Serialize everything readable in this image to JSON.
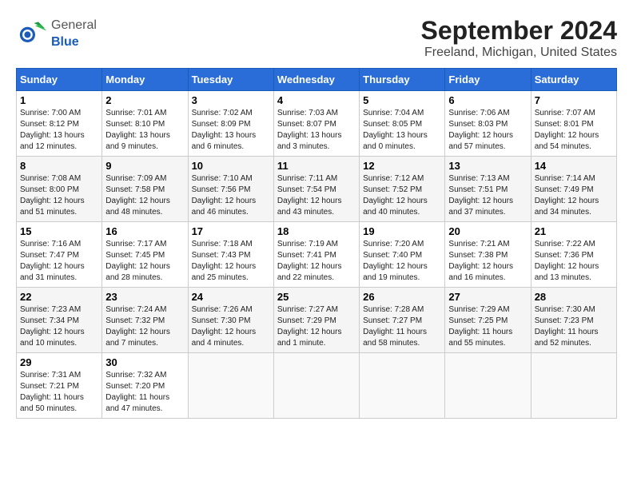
{
  "header": {
    "logo_general": "General",
    "logo_blue": "Blue",
    "title": "September 2024",
    "subtitle": "Freeland, Michigan, United States"
  },
  "weekdays": [
    "Sunday",
    "Monday",
    "Tuesday",
    "Wednesday",
    "Thursday",
    "Friday",
    "Saturday"
  ],
  "weeks": [
    [
      {
        "day": "1",
        "info": "Sunrise: 7:00 AM\nSunset: 8:12 PM\nDaylight: 13 hours\nand 12 minutes."
      },
      {
        "day": "2",
        "info": "Sunrise: 7:01 AM\nSunset: 8:10 PM\nDaylight: 13 hours\nand 9 minutes."
      },
      {
        "day": "3",
        "info": "Sunrise: 7:02 AM\nSunset: 8:09 PM\nDaylight: 13 hours\nand 6 minutes."
      },
      {
        "day": "4",
        "info": "Sunrise: 7:03 AM\nSunset: 8:07 PM\nDaylight: 13 hours\nand 3 minutes."
      },
      {
        "day": "5",
        "info": "Sunrise: 7:04 AM\nSunset: 8:05 PM\nDaylight: 13 hours\nand 0 minutes."
      },
      {
        "day": "6",
        "info": "Sunrise: 7:06 AM\nSunset: 8:03 PM\nDaylight: 12 hours\nand 57 minutes."
      },
      {
        "day": "7",
        "info": "Sunrise: 7:07 AM\nSunset: 8:01 PM\nDaylight: 12 hours\nand 54 minutes."
      }
    ],
    [
      {
        "day": "8",
        "info": "Sunrise: 7:08 AM\nSunset: 8:00 PM\nDaylight: 12 hours\nand 51 minutes."
      },
      {
        "day": "9",
        "info": "Sunrise: 7:09 AM\nSunset: 7:58 PM\nDaylight: 12 hours\nand 48 minutes."
      },
      {
        "day": "10",
        "info": "Sunrise: 7:10 AM\nSunset: 7:56 PM\nDaylight: 12 hours\nand 46 minutes."
      },
      {
        "day": "11",
        "info": "Sunrise: 7:11 AM\nSunset: 7:54 PM\nDaylight: 12 hours\nand 43 minutes."
      },
      {
        "day": "12",
        "info": "Sunrise: 7:12 AM\nSunset: 7:52 PM\nDaylight: 12 hours\nand 40 minutes."
      },
      {
        "day": "13",
        "info": "Sunrise: 7:13 AM\nSunset: 7:51 PM\nDaylight: 12 hours\nand 37 minutes."
      },
      {
        "day": "14",
        "info": "Sunrise: 7:14 AM\nSunset: 7:49 PM\nDaylight: 12 hours\nand 34 minutes."
      }
    ],
    [
      {
        "day": "15",
        "info": "Sunrise: 7:16 AM\nSunset: 7:47 PM\nDaylight: 12 hours\nand 31 minutes."
      },
      {
        "day": "16",
        "info": "Sunrise: 7:17 AM\nSunset: 7:45 PM\nDaylight: 12 hours\nand 28 minutes."
      },
      {
        "day": "17",
        "info": "Sunrise: 7:18 AM\nSunset: 7:43 PM\nDaylight: 12 hours\nand 25 minutes."
      },
      {
        "day": "18",
        "info": "Sunrise: 7:19 AM\nSunset: 7:41 PM\nDaylight: 12 hours\nand 22 minutes."
      },
      {
        "day": "19",
        "info": "Sunrise: 7:20 AM\nSunset: 7:40 PM\nDaylight: 12 hours\nand 19 minutes."
      },
      {
        "day": "20",
        "info": "Sunrise: 7:21 AM\nSunset: 7:38 PM\nDaylight: 12 hours\nand 16 minutes."
      },
      {
        "day": "21",
        "info": "Sunrise: 7:22 AM\nSunset: 7:36 PM\nDaylight: 12 hours\nand 13 minutes."
      }
    ],
    [
      {
        "day": "22",
        "info": "Sunrise: 7:23 AM\nSunset: 7:34 PM\nDaylight: 12 hours\nand 10 minutes."
      },
      {
        "day": "23",
        "info": "Sunrise: 7:24 AM\nSunset: 7:32 PM\nDaylight: 12 hours\nand 7 minutes."
      },
      {
        "day": "24",
        "info": "Sunrise: 7:26 AM\nSunset: 7:30 PM\nDaylight: 12 hours\nand 4 minutes."
      },
      {
        "day": "25",
        "info": "Sunrise: 7:27 AM\nSunset: 7:29 PM\nDaylight: 12 hours\nand 1 minute."
      },
      {
        "day": "26",
        "info": "Sunrise: 7:28 AM\nSunset: 7:27 PM\nDaylight: 11 hours\nand 58 minutes."
      },
      {
        "day": "27",
        "info": "Sunrise: 7:29 AM\nSunset: 7:25 PM\nDaylight: 11 hours\nand 55 minutes."
      },
      {
        "day": "28",
        "info": "Sunrise: 7:30 AM\nSunset: 7:23 PM\nDaylight: 11 hours\nand 52 minutes."
      }
    ],
    [
      {
        "day": "29",
        "info": "Sunrise: 7:31 AM\nSunset: 7:21 PM\nDaylight: 11 hours\nand 50 minutes."
      },
      {
        "day": "30",
        "info": "Sunrise: 7:32 AM\nSunset: 7:20 PM\nDaylight: 11 hours\nand 47 minutes."
      },
      {
        "day": "",
        "info": ""
      },
      {
        "day": "",
        "info": ""
      },
      {
        "day": "",
        "info": ""
      },
      {
        "day": "",
        "info": ""
      },
      {
        "day": "",
        "info": ""
      }
    ]
  ]
}
